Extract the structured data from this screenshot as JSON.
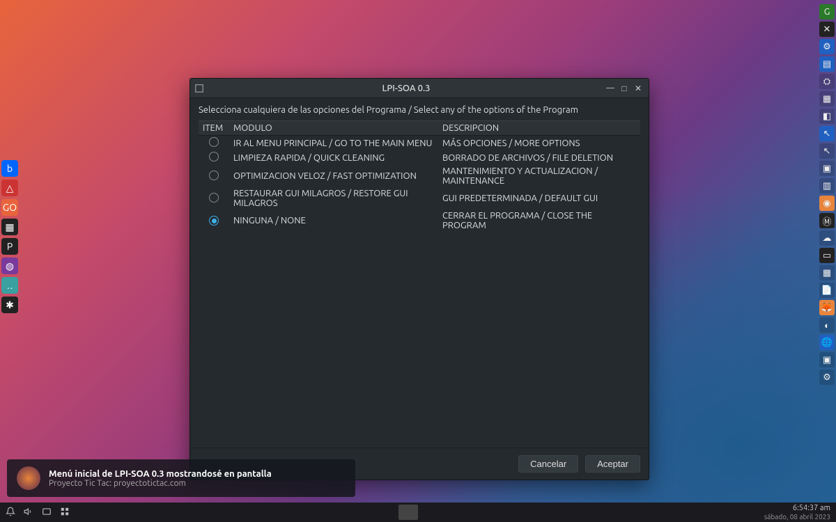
{
  "dialog": {
    "title": "LPI-SOA 0.3",
    "instruction": "Selecciona cualquiera de las opciones del Programa / Select any of the options of the Program",
    "columns": {
      "item": "ITEM",
      "modulo": "MODULO",
      "descripcion": "DESCRIPCION"
    },
    "options": [
      {
        "modulo": "IR AL MENU PRINCIPAL / GO TO THE MAIN MENU",
        "descripcion": "MÁS OPCIONES / MORE OPTIONS",
        "selected": false
      },
      {
        "modulo": "LIMPIEZA RAPIDA / QUICK CLEANING",
        "descripcion": "BORRADO DE ARCHIVOS  / FILE DELETION",
        "selected": false
      },
      {
        "modulo": "OPTIMIZACION VELOZ / FAST OPTIMIZATION",
        "descripcion": "MANTENIMIENTO Y ACTUALIZACION / MAINTENANCE",
        "selected": false
      },
      {
        "modulo": "RESTAURAR GUI MILAGROS / RESTORE GUI MILAGROS",
        "descripcion": "GUI PREDETERMINADA / DEFAULT GUI",
        "selected": false
      },
      {
        "modulo": "NINGUNA / NONE",
        "descripcion": "CERRAR EL PROGRAMA / CLOSE THE PROGRAM",
        "selected": true
      }
    ],
    "buttons": {
      "cancel": "Cancelar",
      "accept": "Aceptar"
    }
  },
  "toast": {
    "title": "Menú inicial de LPI-SOA 0.3 mostrandosé en pantalla",
    "subtitle": "Proyecto Tic Tac: proyectotictac.com"
  },
  "panel": {
    "time": "6:54:37 am",
    "date": "sábado, 08 abril 2023"
  },
  "left_dock": [
    "b",
    "△",
    "GO",
    "▦",
    "P",
    "◍",
    "‥",
    "✱"
  ],
  "right_tray": [
    "G",
    "✕",
    "⚙",
    "▤",
    "⛭",
    "▦",
    "◧",
    "↖",
    "↖",
    "▣",
    "▥",
    "◉",
    "Ⓜ",
    "☁",
    "▭",
    "▦",
    "📄",
    "🦊",
    "◐",
    "🌐",
    "▣",
    "⚙"
  ]
}
